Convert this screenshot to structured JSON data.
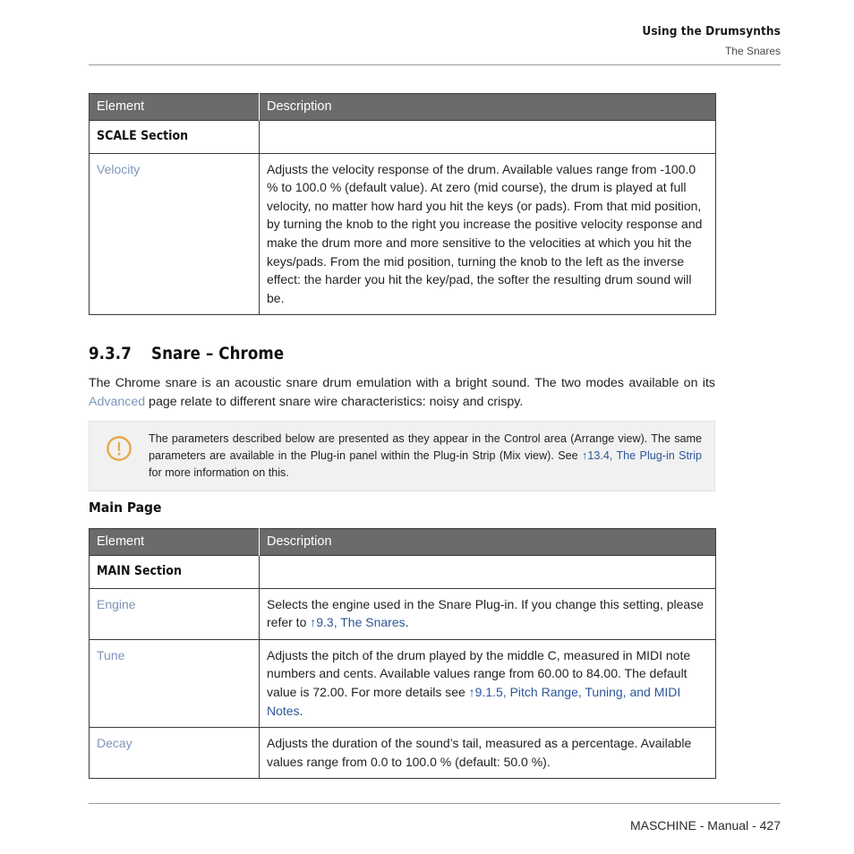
{
  "header": {
    "title": "Using the Drumsynths",
    "subtitle": "The Snares"
  },
  "tables": {
    "scale": {
      "columns": [
        "Element",
        "Description"
      ],
      "rows": [
        {
          "element": "SCALE Section",
          "element_style": "bold",
          "description": ""
        },
        {
          "element": "Velocity",
          "element_style": "link",
          "description": "Adjusts the velocity response of the drum. Available values range from -100.0 % to 100.0 % (default value). At zero (mid course), the drum is played at full velocity, no matter how hard you hit the keys (or pads). From that mid position, by turning the knob to the right you increase the positive velocity response and make the drum more and more sensitive to the velocities at which you hit the keys/pads. From the mid position, turning the knob to the left as the inverse effect: the harder you hit the key/pad, the softer the resulting drum sound will be."
        }
      ]
    },
    "main": {
      "columns": [
        "Element",
        "Description"
      ],
      "rows": [
        {
          "element": "MAIN Section",
          "element_style": "bold",
          "description": ""
        },
        {
          "element": "Engine",
          "element_style": "link",
          "description_pre": "Selects the engine used in the Snare Plug-in. If you change this setting, please refer to ",
          "description_link": "↑9.3, The Snares",
          "description_post": "."
        },
        {
          "element": "Tune",
          "element_style": "link",
          "description_pre": "Adjusts the pitch of the drum played by the middle C, measured in MIDI note numbers and cents. Available values range from 60.00 to 84.00. The default value is 72.00. For more details see ",
          "description_link": "↑9.1.5, Pitch Range, Tuning, and MIDI Notes",
          "description_post": "."
        },
        {
          "element": "Decay",
          "element_style": "link",
          "description": "Adjusts the duration of the sound’s tail, measured as a percentage. Available values range from 0.0 to 100.0 % (default: 50.0 %)."
        }
      ]
    }
  },
  "section": {
    "number": "9.3.7",
    "title": "Snare – Chrome",
    "intro_pre": "The Chrome snare is an acoustic snare drum emulation with a bright sound. The two modes available on its ",
    "intro_link": "Advanced",
    "intro_post": " page relate to different snare wire characteristics: noisy and crispy."
  },
  "note": {
    "icon": "exclamation-circle-icon",
    "icon_color": "#e8a849",
    "text_pre": "The parameters described below are presented as they appear in the Control area (Arrange view). The same parameters are available in the Plug-in panel within the Plug-in Strip (Mix view). See ",
    "text_link": "↑13.4, The Plug-in Strip",
    "text_post": " for more information on this."
  },
  "subheading": {
    "main_page": "Main Page"
  },
  "footer": {
    "text": "MASCHINE - Manual - 427"
  },
  "colors": {
    "table_header_bg": "#6b6b6b",
    "link_blue": "#2c5699",
    "link_soft_blue": "#7f95b8",
    "note_bg": "#f1f1f1",
    "accent_orange": "#e8a849"
  }
}
